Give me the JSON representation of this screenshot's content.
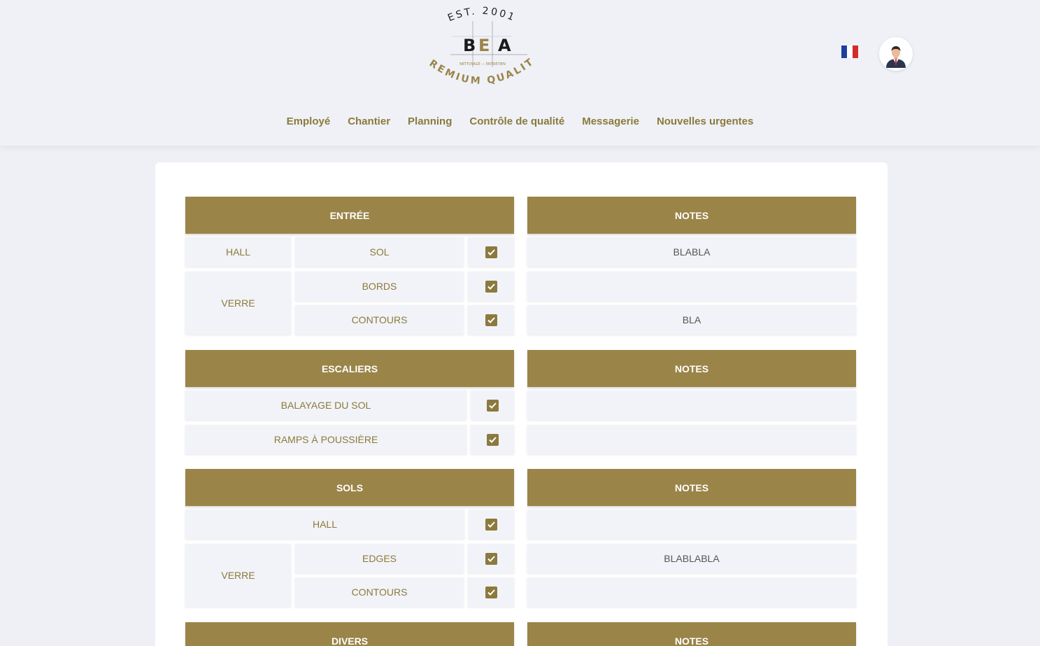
{
  "header": {
    "logo": {
      "est_text": "EST. 2001",
      "initials": [
        "B",
        "E",
        "A"
      ],
      "tagline_small": "NETTOYAGE — ENTRETIEN",
      "tagline": "PREMIUM QUALITY"
    },
    "flag": {
      "icon": "flag-france-icon",
      "colors": [
        "#1f3fa0",
        "#ffffff",
        "#d32a2a"
      ]
    },
    "avatar": {
      "icon": "user-avatar-icon"
    }
  },
  "nav": {
    "items": [
      "Employé",
      "Chantier",
      "Planning",
      "Contrôle de qualité",
      "Messagerie",
      "Nouvelles urgentes"
    ]
  },
  "colors": {
    "accent": "#9a8448",
    "text_accent": "#8a7a3a",
    "cell_bg": "#f2f3f8",
    "background": "#eef0f6"
  },
  "sections": {
    "entree": {
      "title": "ENTRÉE",
      "notes_title": "NOTES",
      "hall": "HALL",
      "sol": "SOL",
      "verre": "VERRE",
      "bords": "BORDS",
      "contours": "CONTOURS",
      "notes": [
        "BLABLA",
        "",
        "BLA"
      ]
    },
    "escaliers": {
      "title": "ESCALIERS",
      "notes_title": "NOTES",
      "balayage": "BALAYAGE DU SOL",
      "ramps": "RAMPS À POUSSIÈRE",
      "notes": [
        "",
        ""
      ]
    },
    "sols": {
      "title": "SOLS",
      "notes_title": "NOTES",
      "hall": "HALL",
      "verre": "VERRE",
      "edges": "EDGES",
      "contours": "CONTOURS",
      "notes": [
        "",
        "BLABLABLA",
        ""
      ]
    },
    "divers": {
      "title": "DIVERS",
      "notes_title": "NOTES"
    }
  }
}
